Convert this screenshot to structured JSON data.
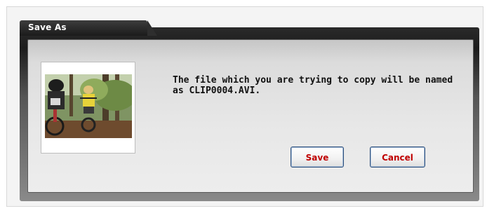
{
  "dialog": {
    "title": "Save As",
    "message": "The file which you are trying to copy will be named as CLIP0004.AVI.",
    "thumbnail": {
      "icon": "video-thumbnail-icon"
    }
  },
  "buttons": {
    "save_label": "Save",
    "cancel_label": "Cancel"
  },
  "colors": {
    "button_text": "#c00000",
    "button_border": "#2c4f7c",
    "header_dark": "#1c1c1c"
  }
}
